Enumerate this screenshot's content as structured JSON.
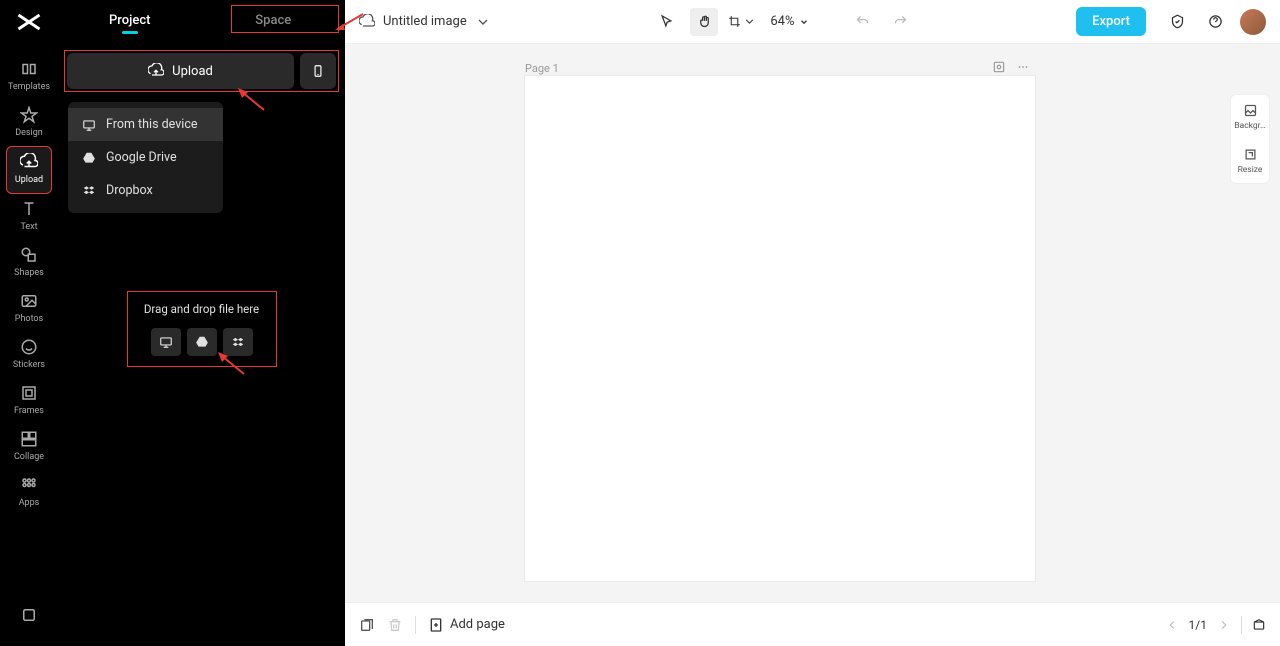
{
  "rail": {
    "items": [
      {
        "label": "Templates"
      },
      {
        "label": "Design"
      },
      {
        "label": "Upload"
      },
      {
        "label": "Text"
      },
      {
        "label": "Shapes"
      },
      {
        "label": "Photos"
      },
      {
        "label": "Stickers"
      },
      {
        "label": "Frames"
      },
      {
        "label": "Collage"
      },
      {
        "label": "Apps"
      }
    ]
  },
  "panel": {
    "tabs": {
      "project": "Project",
      "space": "Space"
    },
    "upload_button": "Upload",
    "dropdown": {
      "from_device": "From this device",
      "google_drive": "Google Drive",
      "dropbox": "Dropbox"
    },
    "drop_text": "Drag and drop file here"
  },
  "topbar": {
    "title": "Untitled image",
    "zoom": "64%",
    "export": "Export"
  },
  "canvas": {
    "page_label": "Page 1"
  },
  "right_tools": {
    "background": "Backgr…",
    "resize": "Resize"
  },
  "bottombar": {
    "add_page": "Add page",
    "page_counter": "1/1"
  }
}
